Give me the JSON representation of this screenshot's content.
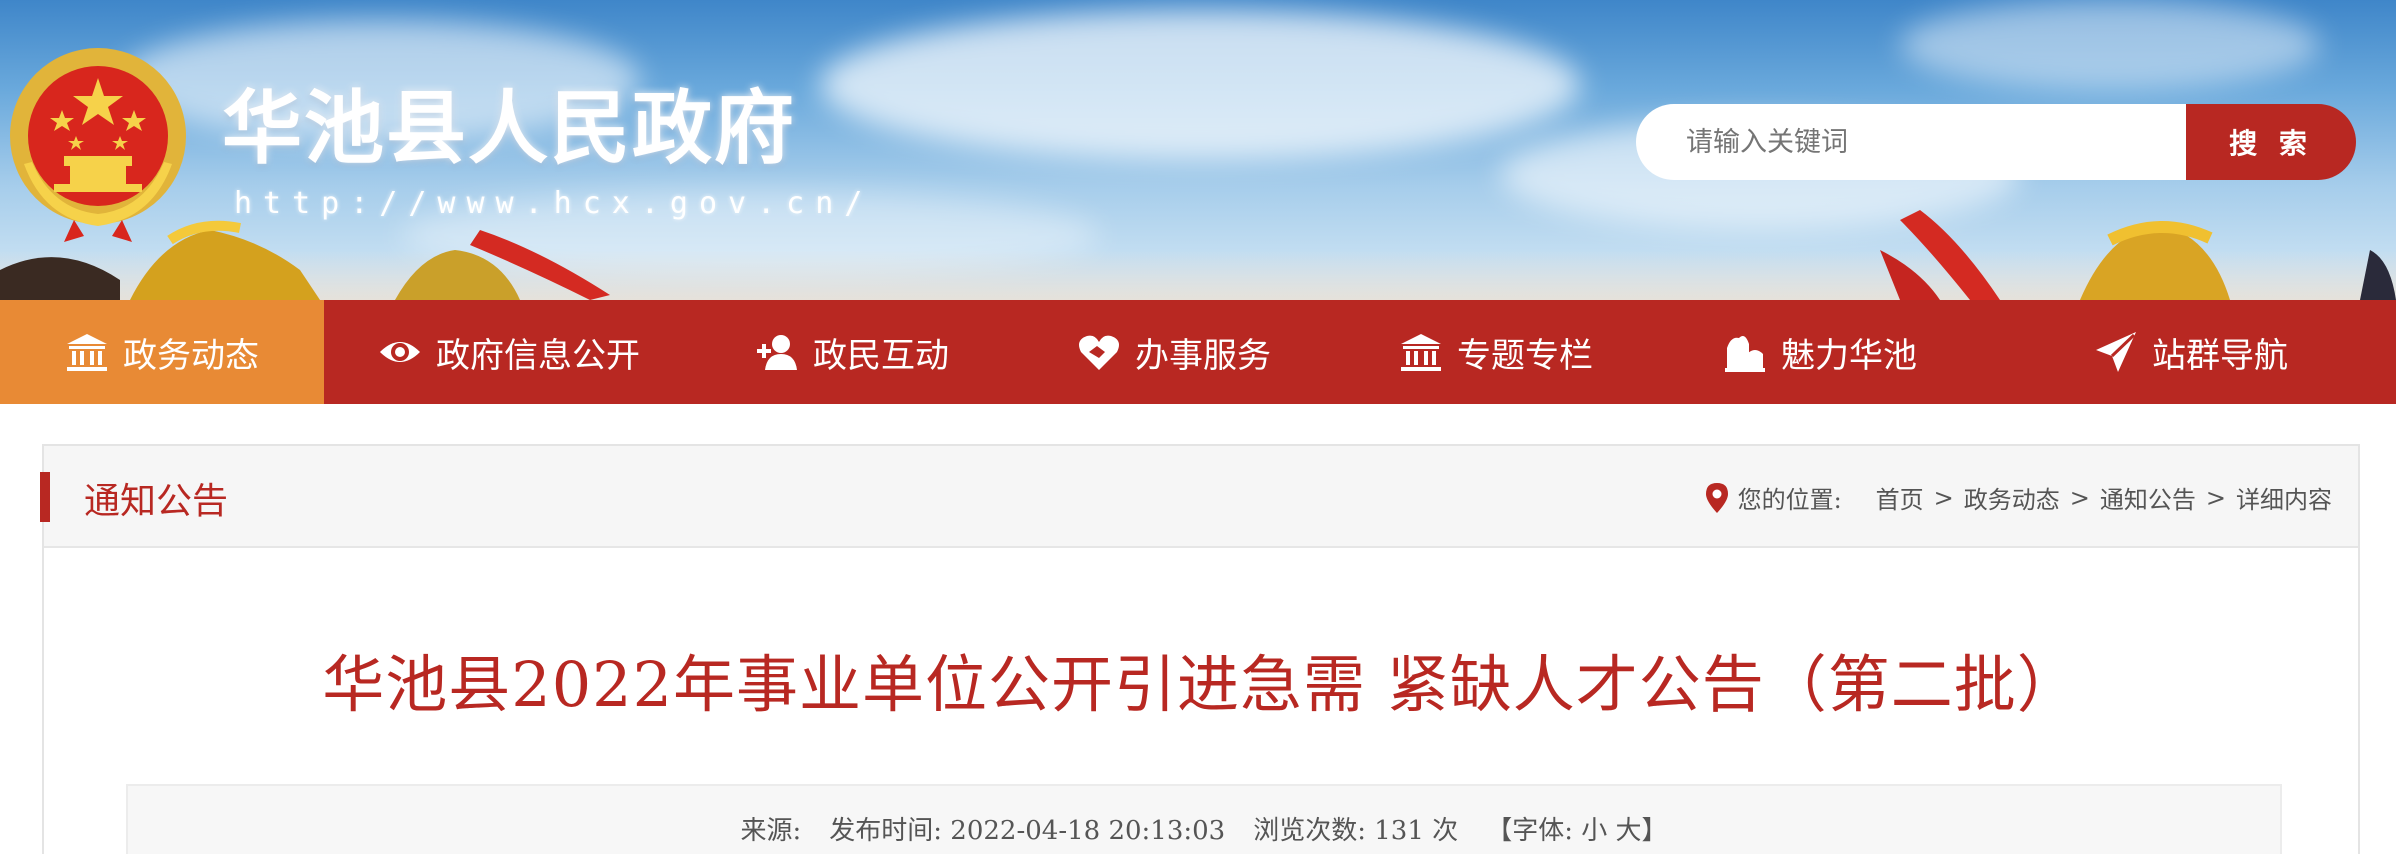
{
  "header": {
    "site_title": "华池县人民政府",
    "site_url": "http://www.hcx.gov.cn/",
    "search": {
      "placeholder": "请输入关键词",
      "button_label": "搜 索"
    }
  },
  "nav": {
    "items": [
      {
        "label": "政务动态",
        "icon": "institution-icon",
        "active": true
      },
      {
        "label": "政府信息公开",
        "icon": "eye-icon",
        "active": false
      },
      {
        "label": "政民互动",
        "icon": "add-user-icon",
        "active": false
      },
      {
        "label": "办事服务",
        "icon": "heart-handshake-icon",
        "active": false
      },
      {
        "label": "专题专栏",
        "icon": "institution-icon",
        "active": false
      },
      {
        "label": "魅力华池",
        "icon": "landmark-icon",
        "active": false
      },
      {
        "label": "站群导航",
        "icon": "send-icon",
        "active": false
      }
    ]
  },
  "section": {
    "title": "通知公告",
    "breadcrumb": {
      "prefix": "您的位置:",
      "items": [
        "首页",
        "政务动态",
        "通知公告",
        "详细内容"
      ],
      "separator": ">"
    }
  },
  "article": {
    "title": "华池县2022年事业单位公开引进急需 紧缺人才公告（第二批）",
    "meta": {
      "source_label": "来源:",
      "publish_label": "发布时间:",
      "publish_time": "2022-04-18 20:13:03",
      "views_label": "浏览次数:",
      "views_count": "131",
      "views_unit": "次",
      "font_open": "【字体:",
      "font_small": "小",
      "font_large": "大】"
    }
  },
  "colors": {
    "brand_red": "#b82822",
    "active_orange": "#e88a35"
  }
}
